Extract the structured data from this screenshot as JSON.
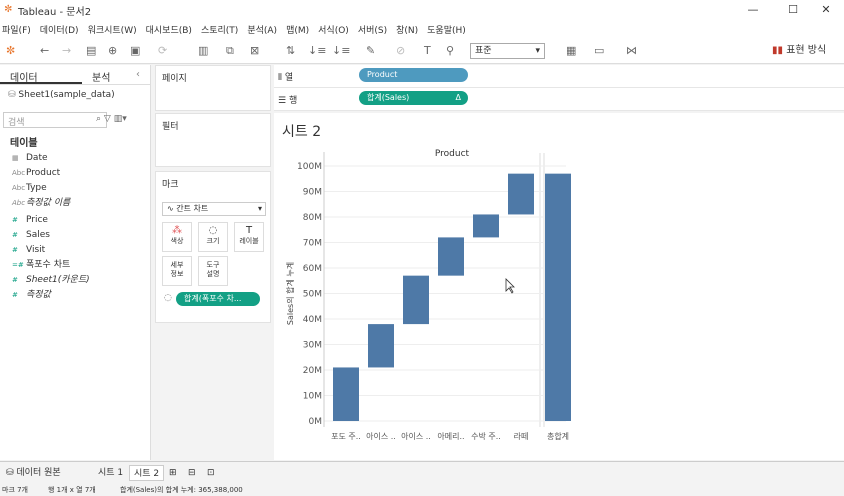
{
  "window": {
    "title": "Tableau - 문서2"
  },
  "menu": [
    "파일(F)",
    "데이터(D)",
    "워크시트(W)",
    "대시보드(B)",
    "스토리(T)",
    "분석(A)",
    "맵(M)",
    "서식(O)",
    "서버(S)",
    "창(N)",
    "도움말(H)"
  ],
  "toolbar": {
    "fit_select": "표준",
    "show_me": "표현 방식"
  },
  "data_pane": {
    "tab_data": "데이터",
    "tab_analysis": "분석",
    "source": "Sheet1(sample_data)",
    "search_placeholder": "검색",
    "tables_header": "테이블",
    "fields": [
      {
        "icon": "calendar-icon",
        "glyph": "▦",
        "name": "Date"
      },
      {
        "icon": "abc-icon",
        "glyph": "Abc",
        "name": "Product"
      },
      {
        "icon": "abc-icon",
        "glyph": "Abc",
        "name": "Type"
      },
      {
        "icon": "abc-icon",
        "glyph": "Abc",
        "name": "측정값 이름"
      },
      {
        "icon": "number-icon",
        "glyph": "#",
        "name": "Price"
      },
      {
        "icon": "number-icon",
        "glyph": "#",
        "name": "Sales"
      },
      {
        "icon": "number-icon",
        "glyph": "#",
        "name": "Visit"
      },
      {
        "icon": "calc-number-icon",
        "glyph": "=#",
        "name": "폭포수 차트"
      },
      {
        "icon": "number-icon",
        "glyph": "#",
        "name": "Sheet1(카운트)"
      },
      {
        "icon": "number-icon",
        "glyph": "#",
        "name": "측정값"
      }
    ]
  },
  "cards": {
    "pages": "페이지",
    "filters": "필터",
    "marks": "마크",
    "mark_type": "간트 차트",
    "mark_buttons": [
      "색상",
      "크기",
      "레이블",
      "세부\n정보",
      "도구\n설명"
    ],
    "mark_pill": "합계(폭포수 차..."
  },
  "shelves": {
    "columns_label": "열",
    "rows_label": "행",
    "columns_pill": "Product",
    "rows_pill": "합계(Sales)",
    "rows_pill_delta": "Δ"
  },
  "view": {
    "sheet_title": "시트 2"
  },
  "chart_data": {
    "type": "bar",
    "subtype": "waterfall",
    "title": "Product",
    "ylabel": "Sales의 합계 누계",
    "categories": [
      "포도 주..",
      "아이스 ..",
      "아이스 ..",
      "아메리..",
      "수박 주..",
      "라떼",
      "총합계"
    ],
    "starts": [
      0,
      21,
      38,
      57,
      72,
      81,
      0
    ],
    "ends": [
      21,
      38,
      57,
      72,
      81,
      97,
      97
    ],
    "ytick_labels": [
      "0M",
      "10M",
      "20M",
      "30M",
      "40M",
      "50M",
      "60M",
      "70M",
      "80M",
      "90M",
      "100M"
    ],
    "ylim": [
      0,
      100
    ],
    "color": "#4e79a7",
    "grid": true
  },
  "bottom_tabs": {
    "datasource": "데이터 원본",
    "tabs": [
      "시트 1",
      "시트 2"
    ],
    "active": "시트 2"
  },
  "status": {
    "marks": "마크 7개",
    "rows": "행 1개 x 열 7개",
    "sum": "합계(Sales)의 합계 누계: 365,388,000"
  }
}
